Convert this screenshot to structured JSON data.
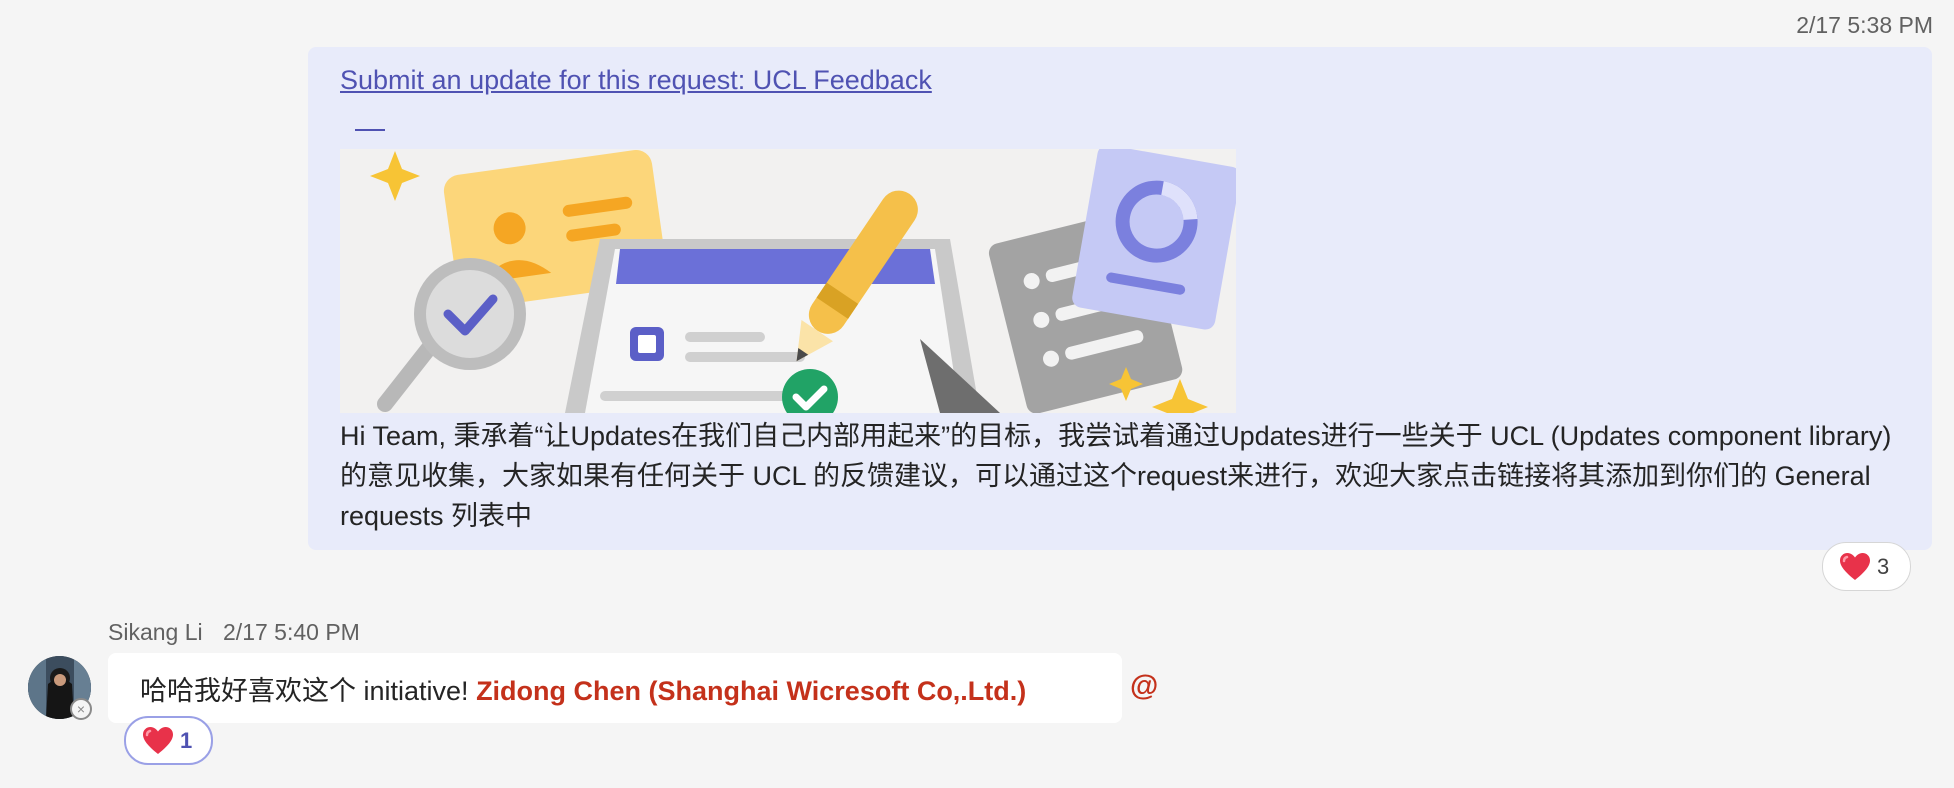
{
  "thread": {
    "own_message": {
      "timestamp": "2/17 5:38 PM",
      "link_text": "Submit an update for this request: UCL Feedback",
      "body": "Hi Team, 秉承着“让Updates在我们自己内部用起来”的目标，我尝试着通过Updates进行一些关于 UCL (Updates component library) 的意见收集，大家如果有任何关于 UCL 的反馈建议，可以通过这个request来进行，欢迎大家点击链接将其添加到你们的 General requests 列表中",
      "reaction": {
        "icon": "heart-icon",
        "count": "3"
      }
    },
    "reply": {
      "sender": "Sikang Li",
      "timestamp": "2/17 5:40 PM",
      "text": "哈哈我好喜欢这个 initiative! ",
      "mention": "Zidong Chen (Shanghai Wicresoft Co,.Ltd.)",
      "at_symbol": "@",
      "reaction": {
        "icon": "heart-icon",
        "count": "1"
      }
    }
  },
  "colors": {
    "background": "#f5f5f5",
    "own_bubble": "#e8ebfa",
    "link": "#4f52b2",
    "mention": "#c4311b",
    "heart": "#e8324a"
  }
}
